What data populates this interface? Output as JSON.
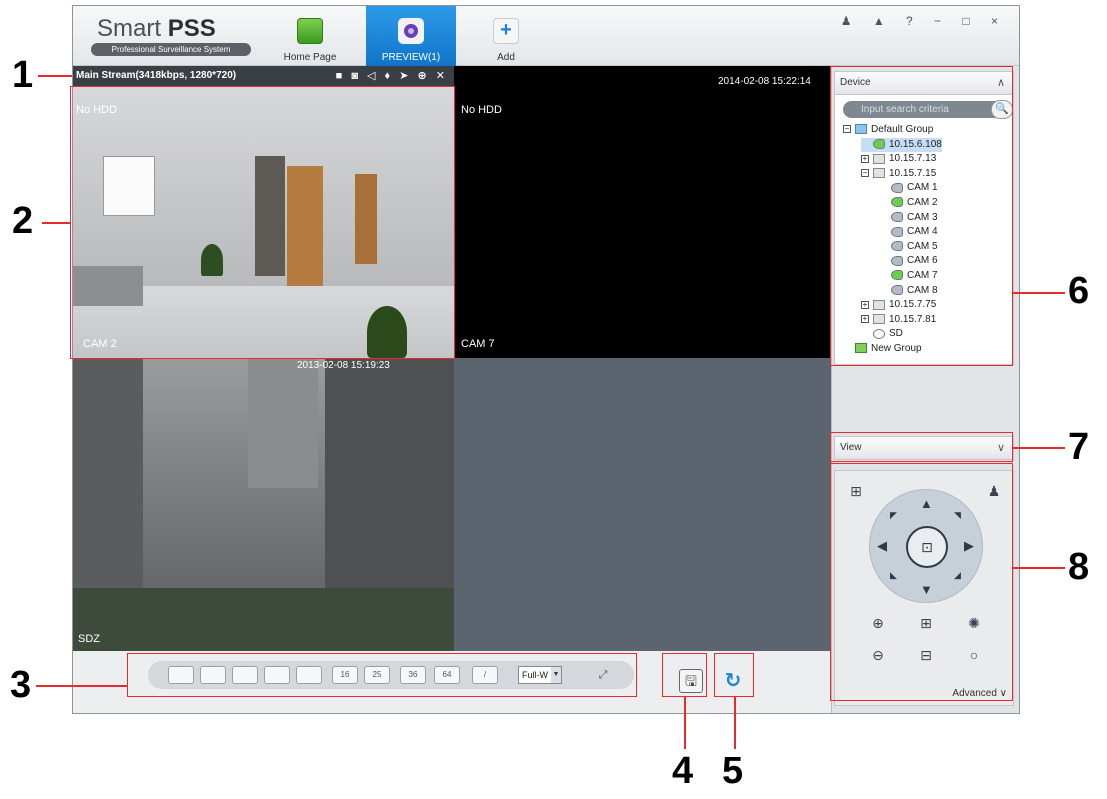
{
  "app": {
    "brand": "Smart",
    "brand_bold": "PSS",
    "subtitle": "Professional Surveillance System",
    "window_controls": "♟ ▲ ? − □ ×"
  },
  "nav": {
    "home": "Home Page",
    "preview": "PREVIEW(1)",
    "add": "Add"
  },
  "stream": {
    "info": "Main Stream(3418kbps, 1280*720)",
    "icons": "■ ◙ ◁ ♦ ➤ ⊕ ✕"
  },
  "cells": {
    "c1": {
      "status": "No HDD",
      "name": "CAM 2"
    },
    "c2": {
      "status": "No HDD",
      "timestamp": "2014-02-08 15:22:14",
      "name": "CAM 7"
    },
    "c3": {
      "timestamp": "2013-02-08 15:19:23",
      "name": "SDZ"
    }
  },
  "layouts": {
    "labels": [
      "",
      "",
      "",
      "",
      "",
      "16",
      "25",
      "36",
      "64",
      "/"
    ],
    "fullw": "Full-W",
    "fullw_arrow": "▼",
    "fullscreen": "⤢"
  },
  "actions": {
    "save": "🖫",
    "refresh": "↻"
  },
  "device_panel": {
    "title": "Device",
    "search_placeholder": "Input search criteria",
    "search_icon": "🔍",
    "tree": [
      {
        "label": "Default Group",
        "indent": 0,
        "icon": "folder",
        "pm": "−"
      },
      {
        "label": "10.15.6.108",
        "indent": 1,
        "icon": "cam-on",
        "pm": "",
        "selected": true
      },
      {
        "label": "10.15.7.13",
        "indent": 1,
        "icon": "dvr",
        "pm": "+"
      },
      {
        "label": "10.15.7.15",
        "indent": 1,
        "icon": "dvr",
        "pm": "−"
      },
      {
        "label": "CAM 1",
        "indent": 2,
        "icon": "cam",
        "pm": ""
      },
      {
        "label": "CAM 2",
        "indent": 2,
        "icon": "cam-on",
        "pm": ""
      },
      {
        "label": "CAM 3",
        "indent": 2,
        "icon": "cam",
        "pm": ""
      },
      {
        "label": "CAM 4",
        "indent": 2,
        "icon": "cam",
        "pm": ""
      },
      {
        "label": "CAM 5",
        "indent": 2,
        "icon": "cam",
        "pm": ""
      },
      {
        "label": "CAM 6",
        "indent": 2,
        "icon": "cam",
        "pm": ""
      },
      {
        "label": "CAM 7",
        "indent": 2,
        "icon": "cam-on",
        "pm": ""
      },
      {
        "label": "CAM 8",
        "indent": 2,
        "icon": "cam",
        "pm": ""
      },
      {
        "label": "10.15.7.75",
        "indent": 1,
        "icon": "dvr",
        "pm": "+"
      },
      {
        "label": "10.15.7.81",
        "indent": 1,
        "icon": "dvr",
        "pm": "+"
      },
      {
        "label": "SD",
        "indent": 1,
        "icon": "sd",
        "pm": ""
      },
      {
        "label": "New Group",
        "indent": 0,
        "icon": "newgrp",
        "pm": ""
      }
    ]
  },
  "view_panel": {
    "title": "View"
  },
  "ptz": {
    "advanced": "Advanced",
    "chevron": "∨",
    "up_chevron": "∧"
  },
  "callouts": [
    "1",
    "2",
    "3",
    "4",
    "5",
    "6",
    "7",
    "8"
  ]
}
